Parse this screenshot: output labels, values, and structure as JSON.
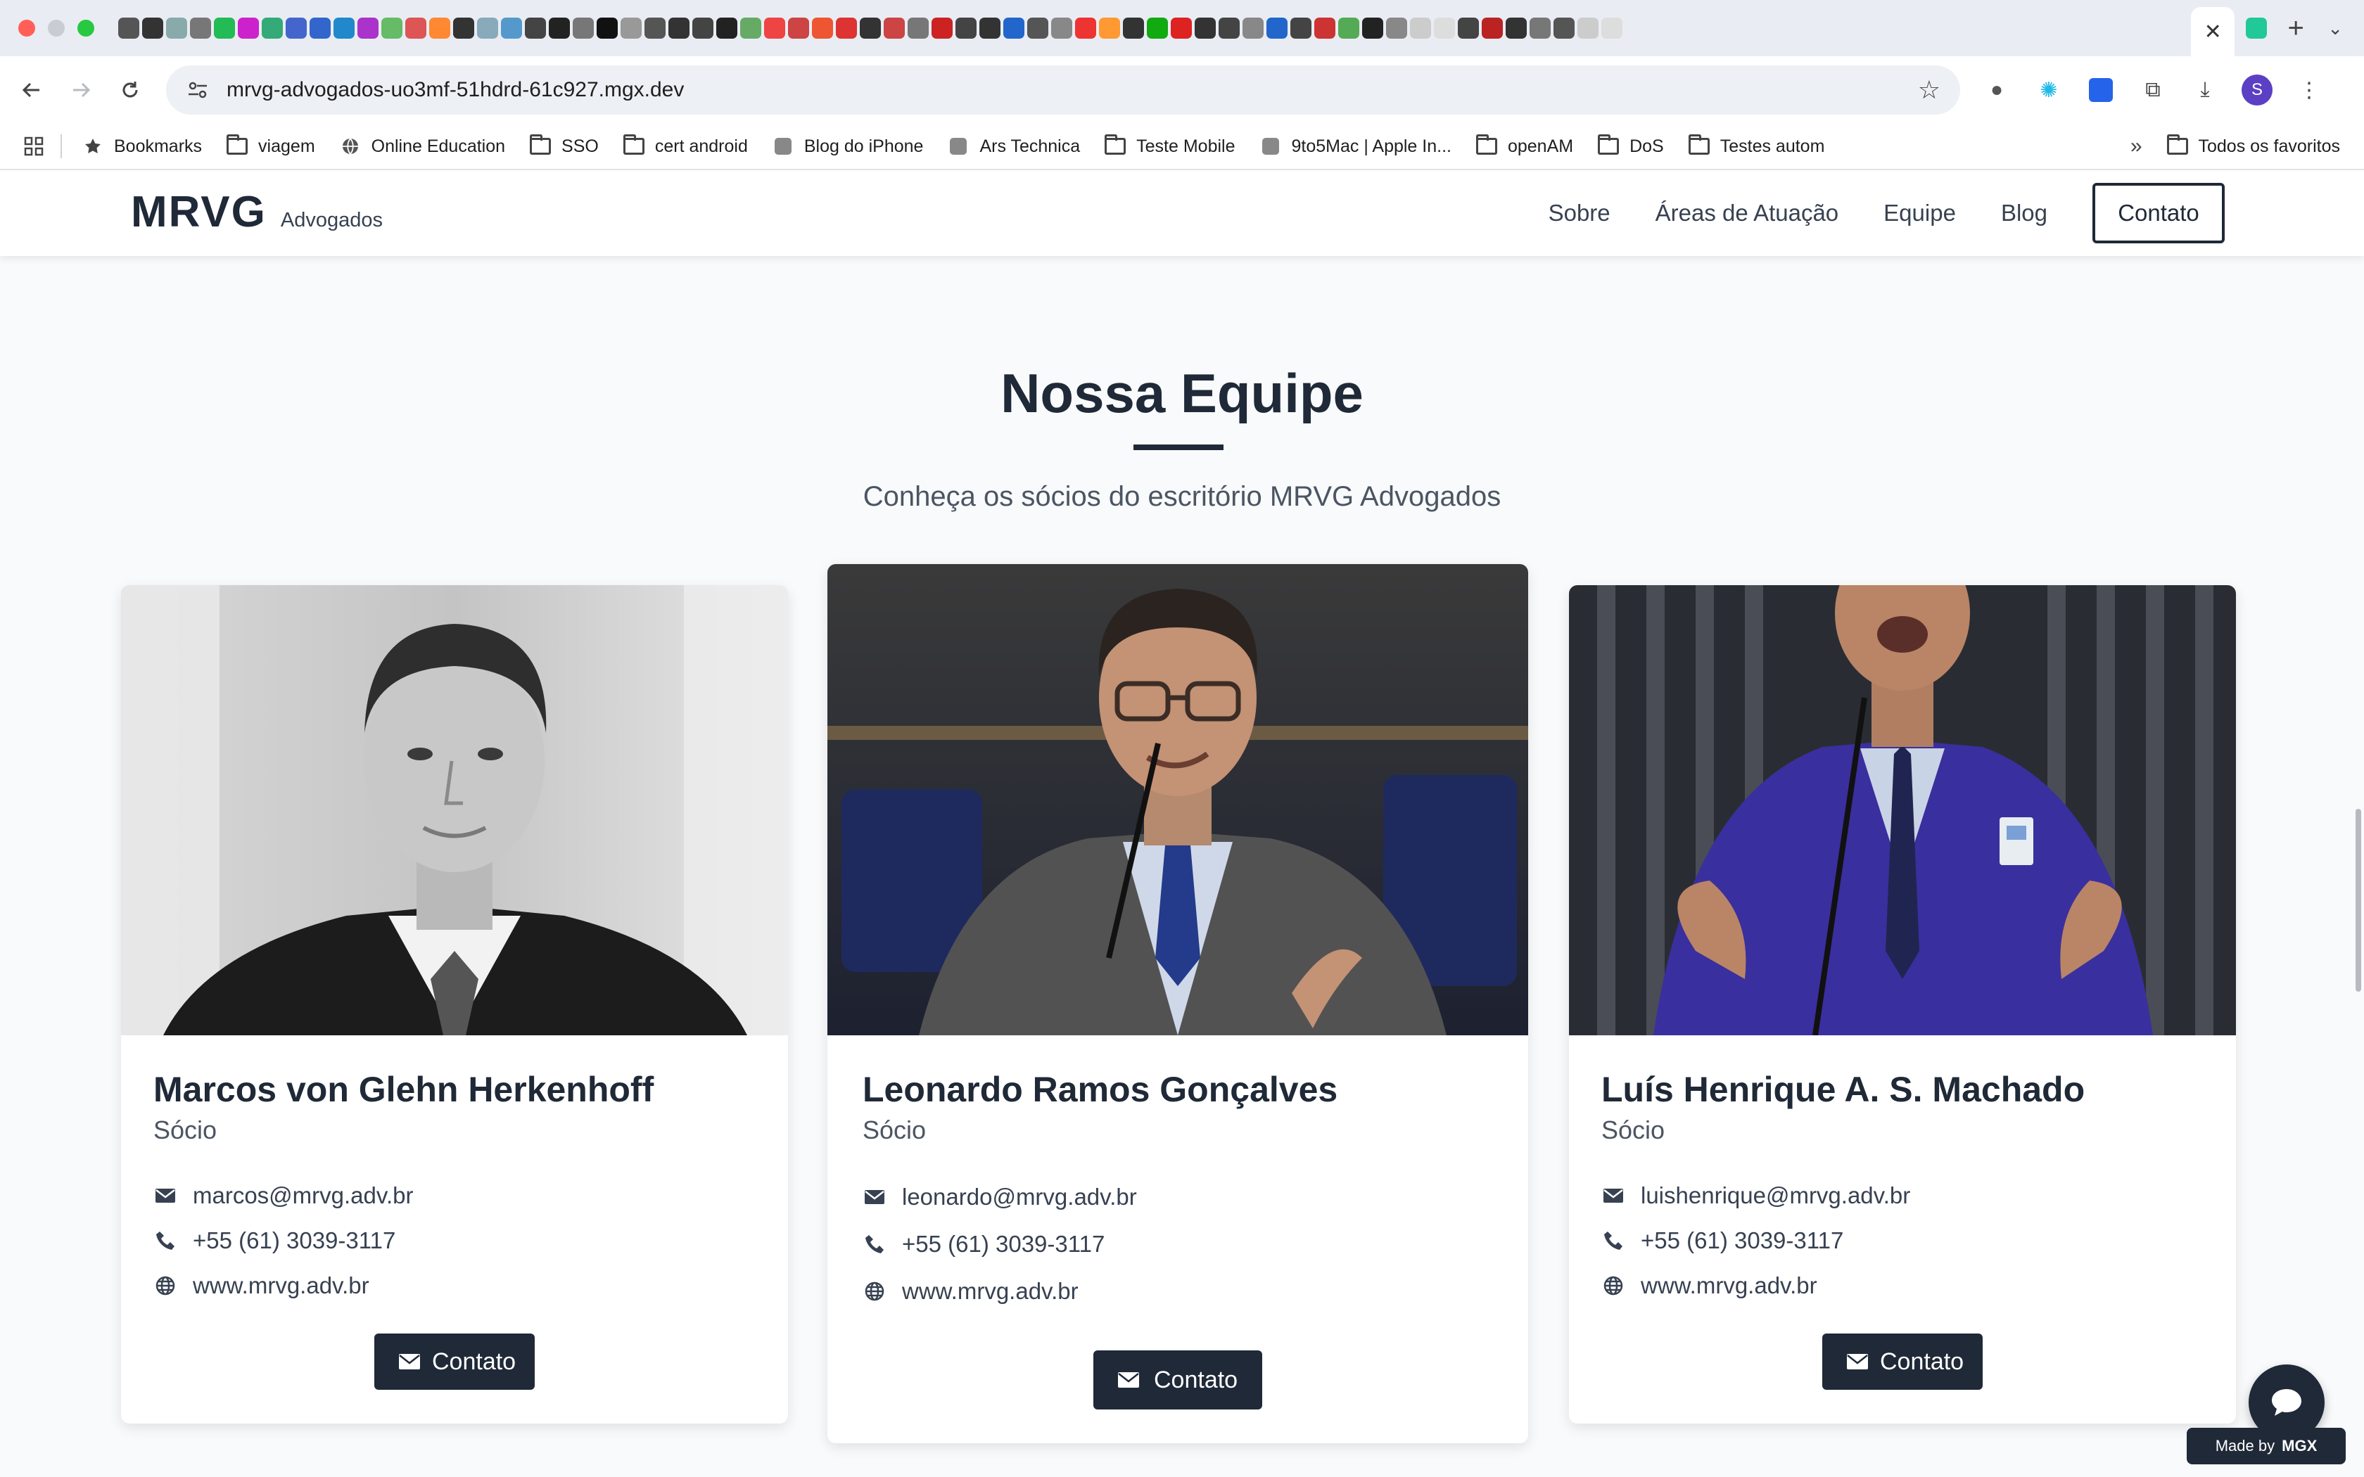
{
  "browser": {
    "url": "mrvg-advogados-uo3mf-51hdrd-61c927.mgx.dev",
    "profile_initial": "S",
    "tab_close": "✕",
    "new_tab": "+",
    "bookmarks": [
      {
        "label": "Bookmarks",
        "icon": "star-icon"
      },
      {
        "label": "viagem",
        "icon": "folder-icon"
      },
      {
        "label": "Online Education",
        "icon": "globe-icon"
      },
      {
        "label": "SSO",
        "icon": "folder-icon"
      },
      {
        "label": "cert android",
        "icon": "folder-icon"
      },
      {
        "label": "Blog do iPhone",
        "icon": "site-icon"
      },
      {
        "label": "Ars Technica",
        "icon": "site-icon"
      },
      {
        "label": "Teste Mobile",
        "icon": "folder-icon"
      },
      {
        "label": "9to5Mac | Apple In...",
        "icon": "site-icon"
      },
      {
        "label": "openAM",
        "icon": "folder-icon"
      },
      {
        "label": "DoS",
        "icon": "folder-icon"
      },
      {
        "label": "Testes autom",
        "icon": "folder-icon"
      }
    ],
    "all_bookmarks": "Todos os favoritos"
  },
  "site": {
    "logo": "MRVG",
    "logo_sub": "Advogados",
    "nav": [
      "Sobre",
      "Áreas de Atuação",
      "Equipe",
      "Blog"
    ],
    "nav_cta": "Contato"
  },
  "section": {
    "title": "Nossa Equipe",
    "subtitle": "Conheça os sócios do escritório MRVG Advogados"
  },
  "team": [
    {
      "name": "Marcos von Glehn Herkenhoff",
      "role": "Sócio",
      "email": "marcos@mrvg.adv.br",
      "phone": "+55 (61) 3039-3117",
      "website": "www.mrvg.adv.br",
      "button": "Contato"
    },
    {
      "name": "Leonardo Ramos Gonçalves",
      "role": "Sócio",
      "email": "leonardo@mrvg.adv.br",
      "phone": "+55 (61) 3039-3117",
      "website": "www.mrvg.adv.br",
      "button": "Contato"
    },
    {
      "name": "Luís Henrique A. S. Machado",
      "role": "Sócio",
      "email": "luishenrique@mrvg.adv.br",
      "phone": "+55 (61) 3039-3117",
      "website": "www.mrvg.adv.br",
      "button": "Contato"
    }
  ],
  "badge": {
    "made_by": "Made by",
    "brand": "MGX"
  },
  "colors": {
    "dark": "#1f2937",
    "bg": "#f9fafb",
    "suit_blue": "#3a2f9e"
  }
}
